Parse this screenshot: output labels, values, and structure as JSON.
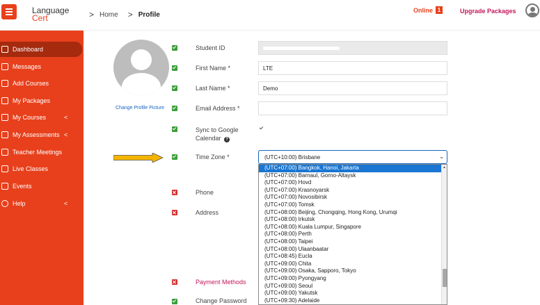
{
  "header": {
    "logo_line1": "Language",
    "logo_line2": "Cert",
    "crumb_sep": ">",
    "crumb_home": "Home",
    "crumb_profile": "Profile",
    "online_label": "Online",
    "online_count": "1",
    "upgrade_label": "Upgrade Packages"
  },
  "sidebar": {
    "items": [
      {
        "label": "Dashboard",
        "icon": "home-icon"
      },
      {
        "label": "Messages",
        "icon": "mail-icon"
      },
      {
        "label": "Add Courses",
        "icon": "bag-icon"
      },
      {
        "label": "My Packages",
        "icon": "bag-icon"
      },
      {
        "label": "My Courses",
        "icon": "mortarboard-icon",
        "chevron": "<"
      },
      {
        "label": "My Assessments",
        "icon": "document-icon",
        "chevron": "<"
      },
      {
        "label": "Teacher Meetings",
        "icon": "chat-icon"
      },
      {
        "label": "Live Classes",
        "icon": "screen-icon"
      },
      {
        "label": "Events",
        "icon": "calendar-icon"
      },
      {
        "label": "Help",
        "icon": "lifebuoy-icon",
        "chevron": "<"
      }
    ]
  },
  "profile": {
    "change_picture": "Change Profile Picture",
    "student_id_label": "Student ID",
    "first_name_label": "First Name *",
    "first_name_value": "LTE",
    "last_name_label": "Last Name *",
    "last_name_value": "Demo",
    "email_label": "Email Address *",
    "sync_label_1": "Sync to Google",
    "sync_label_2": "Calendar",
    "help_glyph": "?",
    "timezone_label": "Time Zone *",
    "timezone_value": "(UTC+10:00) Brisbane",
    "timezone_caret": "⌄",
    "phone_label": "Phone",
    "address_label": "Address",
    "payment_label": "Payment Methods",
    "password_label": "Change Password"
  },
  "timezone_options": [
    "(UTC+07:00) Bangkok, Hanoi, Jakarta",
    "(UTC+07:00) Barnaul, Gorno-Altaysk",
    "(UTC+07:00) Hovd",
    "(UTC+07:00) Krasnoyarsk",
    "(UTC+07:00) Novosibirsk",
    "(UTC+07:00) Tomsk",
    "(UTC+08:00) Beijing, Chongqing, Hong Kong, Urumqi",
    "(UTC+08:00) Irkutsk",
    "(UTC+08:00) Kuala Lumpur, Singapore",
    "(UTC+08:00) Perth",
    "(UTC+08:00) Taipei",
    "(UTC+08:00) Ulaanbaatar",
    "(UTC+08:45) Eucla",
    "(UTC+09:00) Chita",
    "(UTC+09:00) Osaka, Sapporo, Tokyo",
    "(UTC+09:00) Pyongyang",
    "(UTC+09:00) Seoul",
    "(UTC+09:00) Yakutsk",
    "(UTC+09:30) Adelaide"
  ],
  "colors": {
    "brand": "#e8401c",
    "active": "#a52a0e",
    "ok": "#3a9e3a",
    "error": "#d32f2f",
    "link": "#1565c0",
    "highlight": "#1976d2",
    "arrow": "#f5b400"
  }
}
